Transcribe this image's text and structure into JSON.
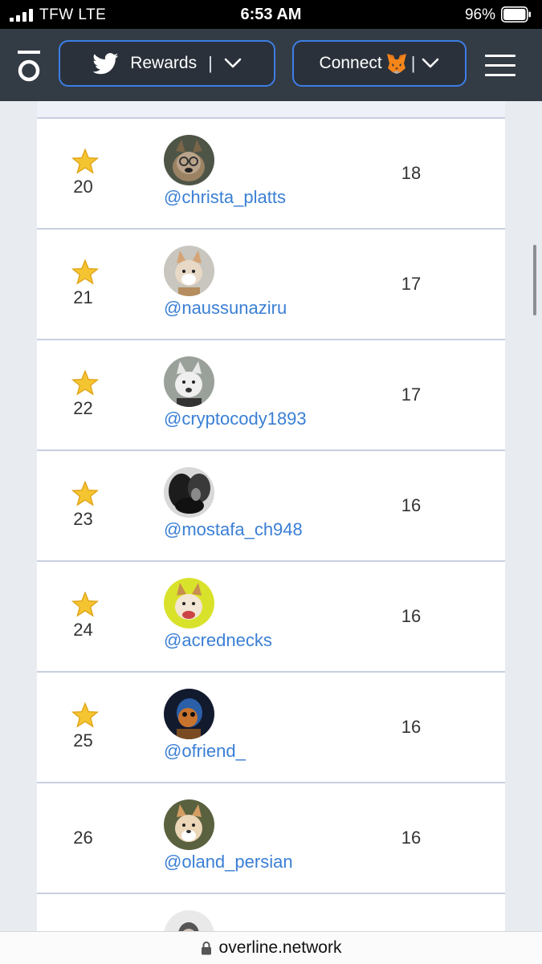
{
  "status_bar": {
    "carrier": "TFW  LTE",
    "time": "6:53 AM",
    "battery": "96%"
  },
  "nav": {
    "rewards_label": "Rewards",
    "separator": "|",
    "connect_label": "Connect"
  },
  "leaderboard": {
    "rows": [
      {
        "rank": "20",
        "starred": true,
        "handle": "@christa_platts",
        "points": "18"
      },
      {
        "rank": "21",
        "starred": true,
        "handle": "@naussunaziru",
        "points": "17"
      },
      {
        "rank": "22",
        "starred": true,
        "handle": "@cryptocody1893",
        "points": "17"
      },
      {
        "rank": "23",
        "starred": true,
        "handle": "@mostafa_ch948",
        "points": "16"
      },
      {
        "rank": "24",
        "starred": true,
        "handle": "@acrednecks",
        "points": "16"
      },
      {
        "rank": "25",
        "starred": true,
        "handle": "@ofriend_",
        "points": "16"
      },
      {
        "rank": "26",
        "starred": false,
        "handle": "@oland_persian",
        "points": "16"
      }
    ]
  },
  "url_bar": {
    "domain": "overline.network"
  },
  "colors": {
    "nav_background": "#333b45",
    "accent_border": "#3d7ee6",
    "handle_link": "#3a7fd5",
    "star": "#f5c531"
  }
}
